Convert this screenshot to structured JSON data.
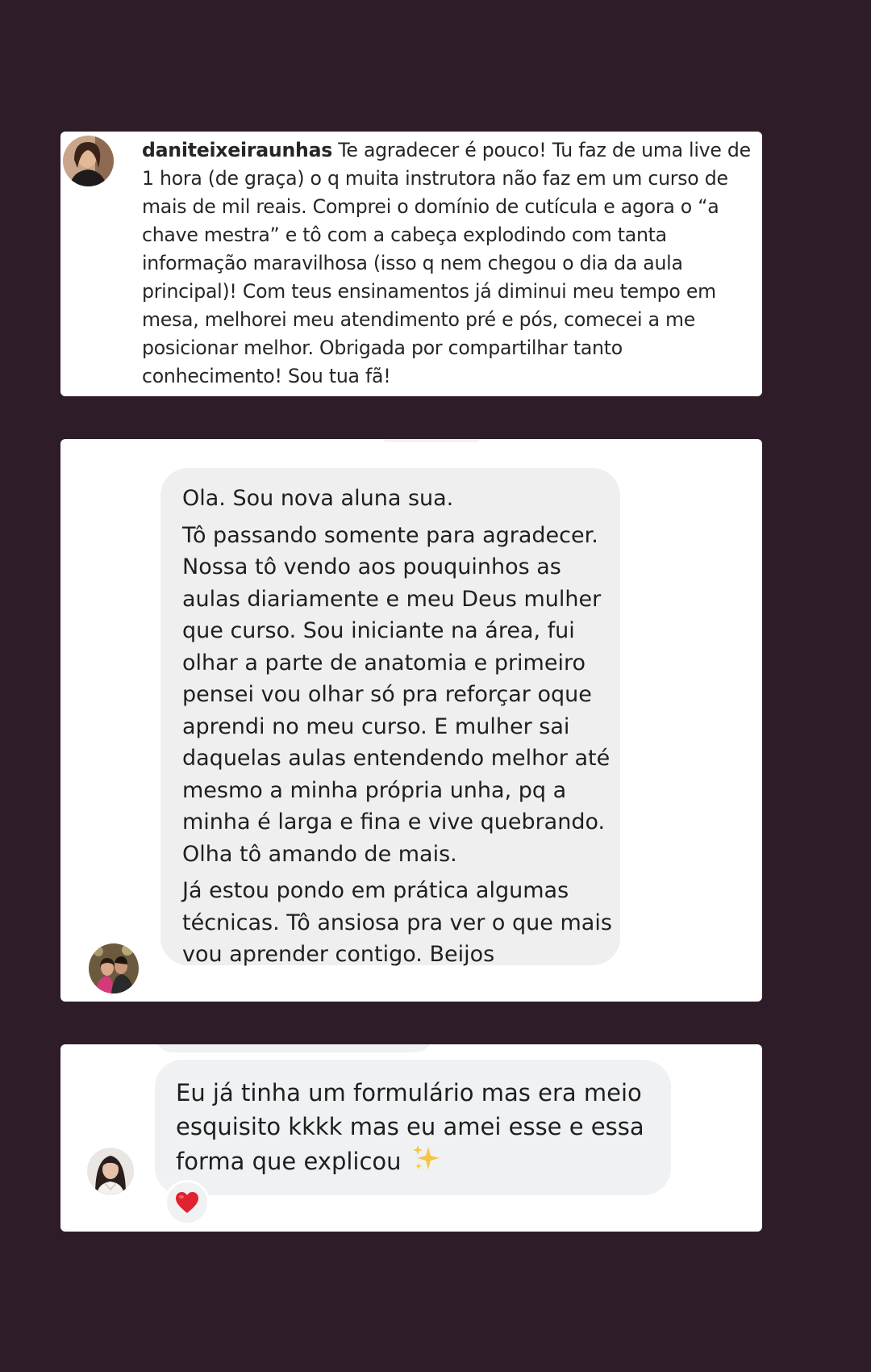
{
  "comment_card": {
    "username": "daniteixeiraunhas",
    "text": "Te agradecer é pouco! Tu faz de uma live de 1 hora (de graça) o q muita instrutora não faz em um curso de mais de mil reais. Comprei o domínio de cutícula e agora o “a chave mestra” e tô com a cabeça explodindo com tanta informação maravilhosa (isso q nem chegou o dia da aula principal)! Com teus ensinamentos já diminui meu tempo em mesa, melhorei meu atendimento pré e pós, comecei a me posicionar melhor. Obrigada por compartilhar tanto conhecimento! Sou tua fã!"
  },
  "message_card": {
    "paragraphs": [
      "Ola. Sou nova aluna sua.",
      "Tô passando somente para agradecer. Nossa tô vendo aos pouquinhos as aulas diariamente e meu Deus mulher que curso. Sou iniciante na área, fui olhar a parte de anatomia e primeiro pensei vou olhar só pra reforçar oque aprendi no meu curso. E mulher sai daquelas aulas entendendo melhor até mesmo a minha própria unha, pq a minha é larga e fina e vive quebrando. Olha tô amando de mais.",
      "Já estou pondo em prática algumas técnicas. Tô ansiosa pra ver o que mais vou aprender contigo. Beijos"
    ]
  },
  "reply_card": {
    "text": "Eu já tinha um formulário mas era meio esquisito kkkk mas eu amei esse e essa forma que explicou",
    "emoji": "sparkles-icon",
    "reaction": "heart-icon",
    "colors": {
      "heart": "#e0232e",
      "sparkle": "#f6c543"
    }
  },
  "colors": {
    "background": "#2e1c29",
    "card": "#ffffff",
    "bubble_gray": "#efefef"
  }
}
